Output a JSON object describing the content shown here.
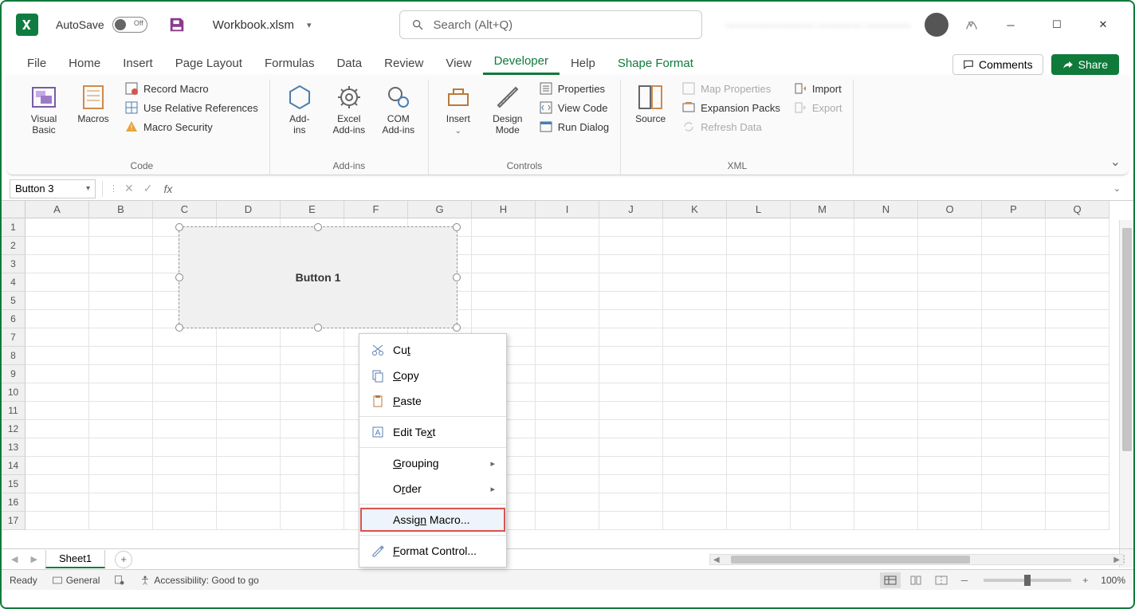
{
  "titlebar": {
    "autosave_label": "AutoSave",
    "autosave_state": "Off",
    "filename": "Workbook.xlsm",
    "search_placeholder": "Search (Alt+Q)",
    "blurred_user": "———————— ———— ————"
  },
  "tabs": {
    "items": [
      "File",
      "Home",
      "Insert",
      "Page Layout",
      "Formulas",
      "Data",
      "Review",
      "View",
      "Developer",
      "Help",
      "Shape Format"
    ],
    "active": "Developer",
    "comments": "Comments",
    "share": "Share"
  },
  "ribbon": {
    "code": {
      "label": "Code",
      "visual_basic": "Visual\nBasic",
      "macros": "Macros",
      "record_macro": "Record Macro",
      "use_relative": "Use Relative References",
      "macro_security": "Macro Security"
    },
    "addins": {
      "label": "Add-ins",
      "addins": "Add-\nins",
      "excel_addins": "Excel\nAdd-ins",
      "com_addins": "COM\nAdd-ins"
    },
    "controls": {
      "label": "Controls",
      "insert": "Insert",
      "design_mode": "Design\nMode",
      "properties": "Properties",
      "view_code": "View Code",
      "run_dialog": "Run Dialog"
    },
    "xml": {
      "label": "XML",
      "source": "Source",
      "map_properties": "Map Properties",
      "expansion_packs": "Expansion Packs",
      "refresh_data": "Refresh Data",
      "import": "Import",
      "export": "Export"
    }
  },
  "namebox": {
    "value": "Button 3"
  },
  "columns": [
    "A",
    "B",
    "C",
    "D",
    "E",
    "F",
    "G",
    "H",
    "I",
    "J",
    "K",
    "L",
    "M",
    "N",
    "O",
    "P",
    "Q"
  ],
  "rows": [
    "1",
    "2",
    "3",
    "4",
    "5",
    "6",
    "7",
    "8",
    "9",
    "10",
    "11",
    "12",
    "13",
    "14",
    "15",
    "16",
    "17"
  ],
  "shape": {
    "label": "Button 1"
  },
  "context_menu": {
    "cut": "Cut",
    "copy": "Copy",
    "paste": "Paste",
    "edit_text": "Edit Text",
    "grouping": "Grouping",
    "order": "Order",
    "assign_macro": "Assign Macro...",
    "format_control": "Format Control..."
  },
  "sheet_tabs": {
    "sheet1": "Sheet1"
  },
  "statusbar": {
    "ready": "Ready",
    "general": "General",
    "accessibility": "Accessibility: Good to go",
    "zoom": "100%"
  }
}
